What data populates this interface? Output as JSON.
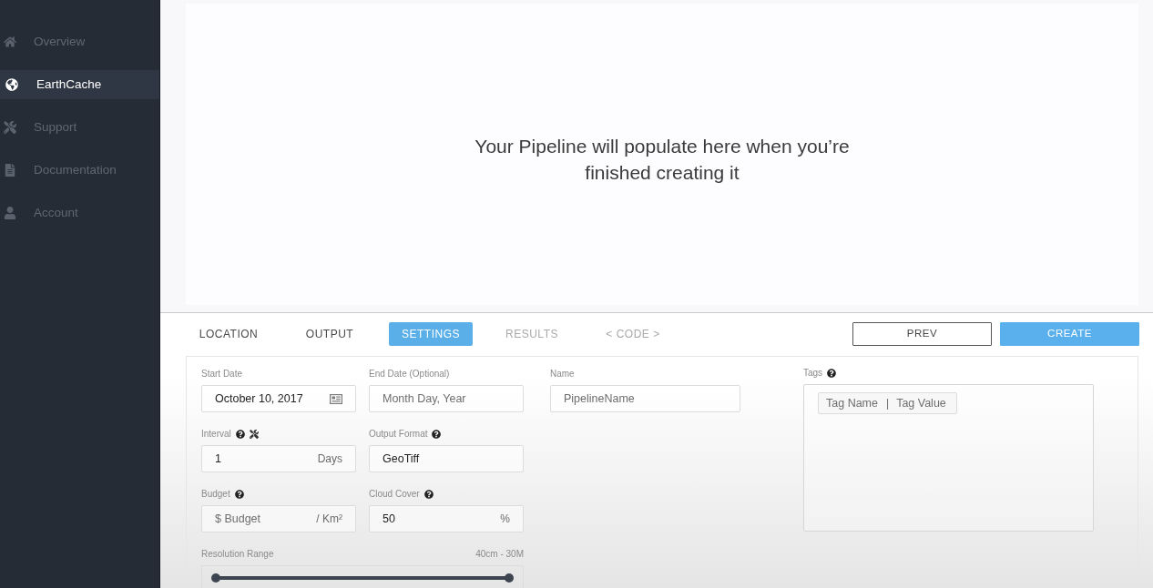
{
  "sidebar": {
    "items": [
      {
        "label": "Overview",
        "selected": false
      },
      {
        "label": "EarthCache",
        "selected": true
      },
      {
        "label": "Support",
        "selected": false
      },
      {
        "label": "Documentation",
        "selected": false
      },
      {
        "label": "Account",
        "selected": false
      }
    ]
  },
  "preview": {
    "message": "Your Pipeline will populate here when you’re finished creating it"
  },
  "tabs": [
    {
      "label": "LOCATION",
      "selected": false,
      "disabled": false
    },
    {
      "label": "OUTPUT",
      "selected": false,
      "disabled": false
    },
    {
      "label": "SETTINGS",
      "selected": true,
      "disabled": false
    },
    {
      "label": "RESULTS",
      "selected": false,
      "disabled": true
    },
    {
      "label": "< CODE >",
      "selected": false,
      "disabled": true
    }
  ],
  "actions": [
    {
      "label": "PREV",
      "kind": "outline"
    },
    {
      "label": "CREATE",
      "kind": "primary"
    }
  ],
  "form": {
    "start_date": {
      "label": "Start Date",
      "help": false,
      "value": "October 10, 2017"
    },
    "end_date": {
      "label": "End Date (Optional)",
      "help": false,
      "placeholder": "Month Day, Year"
    },
    "name": {
      "label": "Name",
      "help": false,
      "placeholder": "PipelineName"
    },
    "tags": {
      "label": "Tags",
      "help": true,
      "name_placeholder": "Tag Name",
      "separator": "|",
      "value_placeholder": "Tag Value"
    },
    "interval": {
      "label": "Interval",
      "help": true,
      "value": "1",
      "unit": "Days"
    },
    "output_format": {
      "label": "Output Format",
      "help": true,
      "value": "GeoTiff"
    },
    "budget": {
      "label": "Budget",
      "help": true,
      "placeholder": "$ Budget",
      "unit": "/ Km²"
    },
    "cloud_cover": {
      "label": "Cloud Cover",
      "help": true,
      "value": "50",
      "unit": "%"
    },
    "resolution_range": {
      "label": "Resolution Range",
      "help": false,
      "reading": "40cm - 30M",
      "thumbs": [
        {
          "level": 0
        },
        {
          "level": 1
        }
      ]
    }
  }
}
